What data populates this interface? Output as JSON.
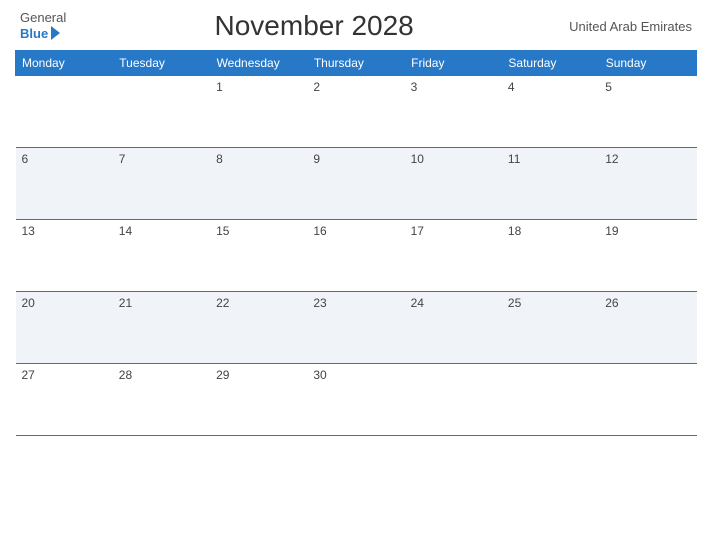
{
  "header": {
    "logo_general": "General",
    "logo_blue": "Blue",
    "title": "November 2028",
    "country": "United Arab Emirates"
  },
  "weekdays": [
    "Monday",
    "Tuesday",
    "Wednesday",
    "Thursday",
    "Friday",
    "Saturday",
    "Sunday"
  ],
  "weeks": [
    [
      {
        "day": "",
        "empty": true
      },
      {
        "day": "",
        "empty": true
      },
      {
        "day": "1"
      },
      {
        "day": "2"
      },
      {
        "day": "3"
      },
      {
        "day": "4"
      },
      {
        "day": "5"
      }
    ],
    [
      {
        "day": "6"
      },
      {
        "day": "7"
      },
      {
        "day": "8"
      },
      {
        "day": "9"
      },
      {
        "day": "10"
      },
      {
        "day": "11"
      },
      {
        "day": "12"
      }
    ],
    [
      {
        "day": "13"
      },
      {
        "day": "14"
      },
      {
        "day": "15"
      },
      {
        "day": "16"
      },
      {
        "day": "17"
      },
      {
        "day": "18"
      },
      {
        "day": "19"
      }
    ],
    [
      {
        "day": "20"
      },
      {
        "day": "21"
      },
      {
        "day": "22"
      },
      {
        "day": "23"
      },
      {
        "day": "24"
      },
      {
        "day": "25"
      },
      {
        "day": "26"
      }
    ],
    [
      {
        "day": "27"
      },
      {
        "day": "28"
      },
      {
        "day": "29"
      },
      {
        "day": "30"
      },
      {
        "day": "",
        "empty": true
      },
      {
        "day": "",
        "empty": true
      },
      {
        "day": "",
        "empty": true
      }
    ]
  ]
}
